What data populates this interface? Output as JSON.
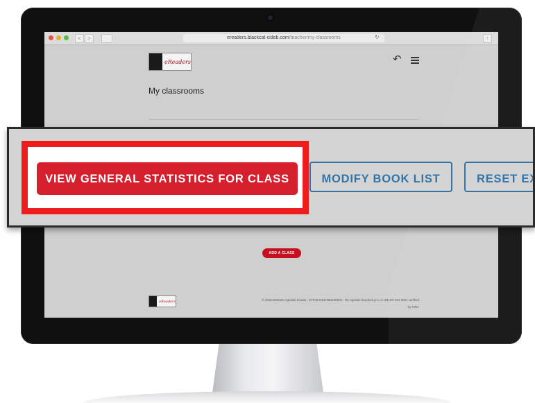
{
  "browser": {
    "url_domain": "ereaders.blackcat-cideb.com",
    "url_path": "/teacher/my-classrooms",
    "back_label": "<",
    "forward_label": ">",
    "reload_glyph": "↻",
    "share_glyph": "↑"
  },
  "header": {
    "logo_text": "eReaders",
    "back_icon": "↶"
  },
  "page": {
    "title": "My classrooms"
  },
  "actions": {
    "view_stats": "VIEW GENERAL STATISTICS FOR CLASS",
    "modify_books": "MODIFY BOOK LIST",
    "reset": "RESET EX",
    "add_class": "ADD A CLASS"
  },
  "footer": {
    "logo_text": "eReaders",
    "copyright": "© 2016-2019 De Agostini Scuola - VAT.ID 01617952180034 - De Agostini Scuola S.p.A. is UNI EN ISO 9001 certified",
    "certified_by": "by RINA"
  },
  "colors": {
    "accent_red": "#d61f2c",
    "highlight_red": "#ee1c1c",
    "outline_blue": "#3374a8"
  }
}
